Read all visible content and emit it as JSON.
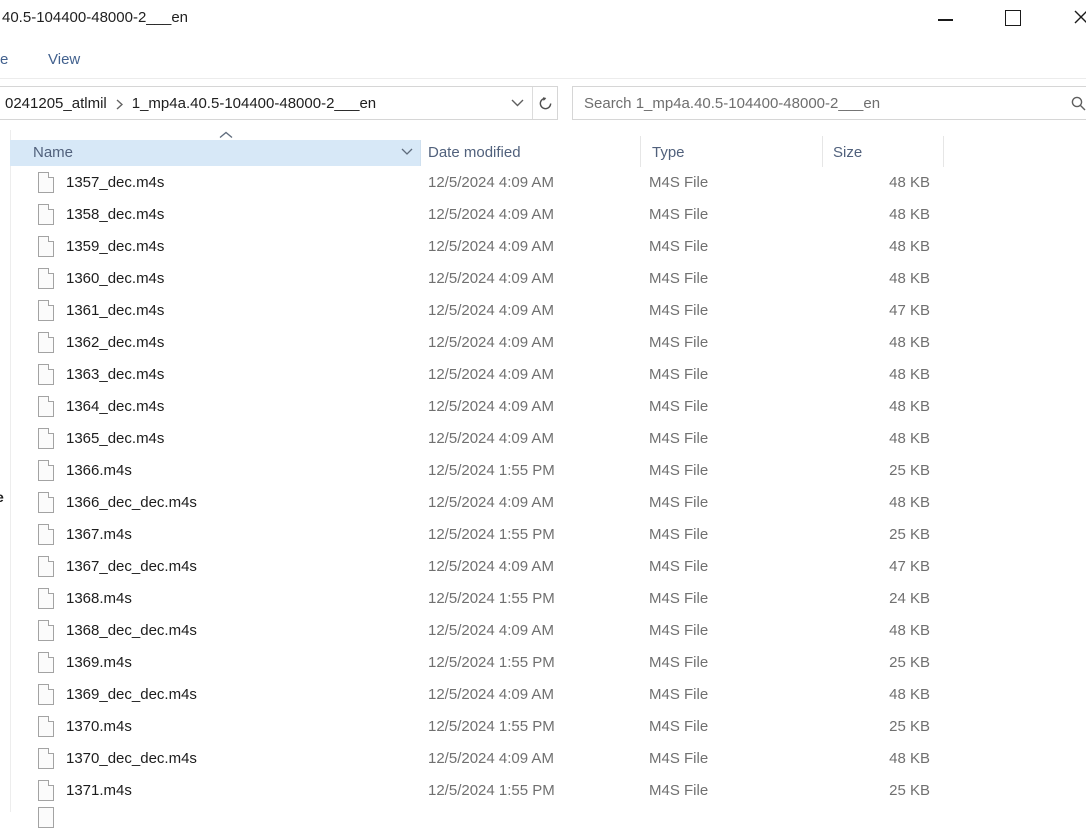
{
  "window": {
    "title": "40.5-104400-48000-2___en",
    "controls": {
      "minimize": "minimize",
      "maximize": "maximize",
      "close": "close"
    }
  },
  "menubar": {
    "partial_tab": "e",
    "view_tab": "View"
  },
  "addressbar": {
    "crumb_parent": "0241205_atlmil",
    "crumb_current": "1_mp4a.40.5-104400-48000-2___en",
    "icons": [
      "chevron-right",
      "chevron-down",
      "refresh"
    ]
  },
  "search": {
    "placeholder": "Search 1_mp4a.40.5-104400-48000-2___en",
    "icon": "magnifier"
  },
  "nav_fragment": "e",
  "columns": {
    "name": "Name",
    "date_modified": "Date modified",
    "type": "Type",
    "size": "Size",
    "sort": {
      "column": "Name",
      "direction": "ascending",
      "icon": "caret-up"
    }
  },
  "files": [
    {
      "name": "1357_dec.m4s",
      "date": "12/5/2024 4:09 AM",
      "type": "M4S File",
      "size": "48 KB"
    },
    {
      "name": "1358_dec.m4s",
      "date": "12/5/2024 4:09 AM",
      "type": "M4S File",
      "size": "48 KB"
    },
    {
      "name": "1359_dec.m4s",
      "date": "12/5/2024 4:09 AM",
      "type": "M4S File",
      "size": "48 KB"
    },
    {
      "name": "1360_dec.m4s",
      "date": "12/5/2024 4:09 AM",
      "type": "M4S File",
      "size": "48 KB"
    },
    {
      "name": "1361_dec.m4s",
      "date": "12/5/2024 4:09 AM",
      "type": "M4S File",
      "size": "47 KB"
    },
    {
      "name": "1362_dec.m4s",
      "date": "12/5/2024 4:09 AM",
      "type": "M4S File",
      "size": "48 KB"
    },
    {
      "name": "1363_dec.m4s",
      "date": "12/5/2024 4:09 AM",
      "type": "M4S File",
      "size": "48 KB"
    },
    {
      "name": "1364_dec.m4s",
      "date": "12/5/2024 4:09 AM",
      "type": "M4S File",
      "size": "48 KB"
    },
    {
      "name": "1365_dec.m4s",
      "date": "12/5/2024 4:09 AM",
      "type": "M4S File",
      "size": "48 KB"
    },
    {
      "name": "1366.m4s",
      "date": "12/5/2024 1:55 PM",
      "type": "M4S File",
      "size": "25 KB"
    },
    {
      "name": "1366_dec_dec.m4s",
      "date": "12/5/2024 4:09 AM",
      "type": "M4S File",
      "size": "48 KB"
    },
    {
      "name": "1367.m4s",
      "date": "12/5/2024 1:55 PM",
      "type": "M4S File",
      "size": "25 KB"
    },
    {
      "name": "1367_dec_dec.m4s",
      "date": "12/5/2024 4:09 AM",
      "type": "M4S File",
      "size": "47 KB"
    },
    {
      "name": "1368.m4s",
      "date": "12/5/2024 1:55 PM",
      "type": "M4S File",
      "size": "24 KB"
    },
    {
      "name": "1368_dec_dec.m4s",
      "date": "12/5/2024 4:09 AM",
      "type": "M4S File",
      "size": "48 KB"
    },
    {
      "name": "1369.m4s",
      "date": "12/5/2024 1:55 PM",
      "type": "M4S File",
      "size": "25 KB"
    },
    {
      "name": "1369_dec_dec.m4s",
      "date": "12/5/2024 4:09 AM",
      "type": "M4S File",
      "size": "48 KB"
    },
    {
      "name": "1370.m4s",
      "date": "12/5/2024 1:55 PM",
      "type": "M4S File",
      "size": "25 KB"
    },
    {
      "name": "1370_dec_dec.m4s",
      "date": "12/5/2024 4:09 AM",
      "type": "M4S File",
      "size": "48 KB"
    },
    {
      "name": "1371.m4s",
      "date": "12/5/2024 1:55 PM",
      "type": "M4S File",
      "size": "25 KB"
    }
  ],
  "colors": {
    "header_hover_bg": "#d7e8f7",
    "header_text": "#51617c",
    "tab_text": "#42618e",
    "secondary_text": "#707070",
    "primary_text": "#1d1d1d",
    "border": "#d6d6d6"
  }
}
